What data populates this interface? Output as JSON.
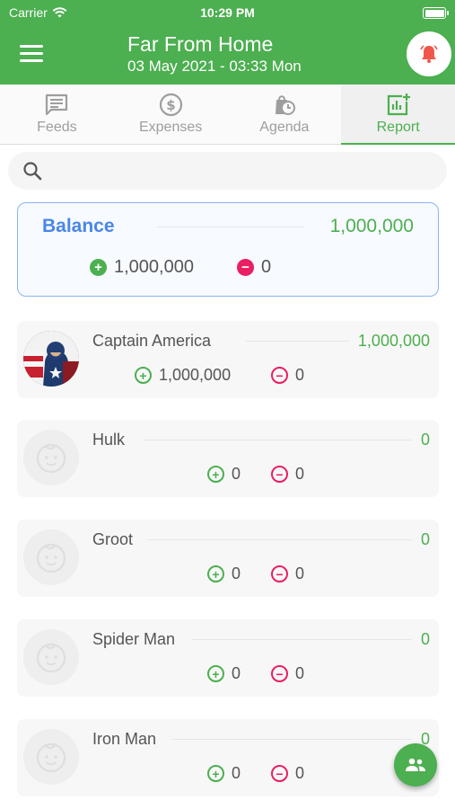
{
  "status_bar": {
    "carrier": "Carrier",
    "time": "10:29 PM"
  },
  "app_bar": {
    "title": "Far From Home",
    "subtitle": "03 May 2021 - 03:33 Mon"
  },
  "tabs": [
    {
      "label": "Feeds",
      "icon": "message-icon",
      "active": false
    },
    {
      "label": "Expenses",
      "icon": "dollar-icon",
      "active": false
    },
    {
      "label": "Agenda",
      "icon": "bag-clock-icon",
      "active": false
    },
    {
      "label": "Report",
      "icon": "report-icon",
      "active": true
    }
  ],
  "search": {
    "placeholder": ""
  },
  "balance": {
    "label": "Balance",
    "amount": "1,000,000",
    "income": "1,000,000",
    "expense": "0"
  },
  "members": [
    {
      "name": "Captain America",
      "total": "1,000,000",
      "income": "1,000,000",
      "expense": "0",
      "avatar": "photo"
    },
    {
      "name": "Hulk",
      "total": "0",
      "income": "0",
      "expense": "0",
      "avatar": "placeholder"
    },
    {
      "name": "Groot",
      "total": "0",
      "income": "0",
      "expense": "0",
      "avatar": "placeholder"
    },
    {
      "name": "Spider Man",
      "total": "0",
      "income": "0",
      "expense": "0",
      "avatar": "placeholder"
    },
    {
      "name": "Iron Man",
      "total": "0",
      "income": "0",
      "expense": "0",
      "avatar": "placeholder"
    }
  ],
  "colors": {
    "primary": "#4caf50",
    "accent_blue": "#4a86e8",
    "minus": "#e91e63",
    "alarm": "#f0564a"
  }
}
